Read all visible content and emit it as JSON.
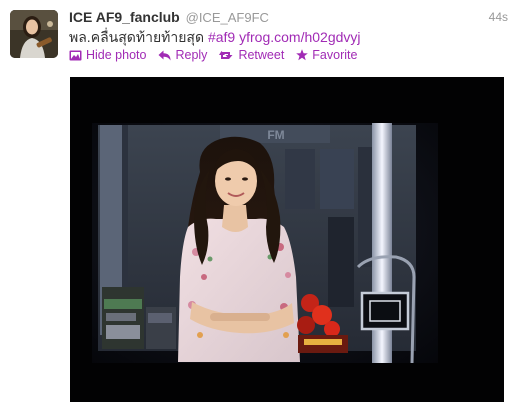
{
  "tweet": {
    "display_name": "ICE AF9_fanclub",
    "screen_name": "@ICE_AF9FC",
    "timestamp": "44s",
    "text_plain": "พล.คลื่นสุดท้ายท้ายสุด",
    "hashtag": "#af9",
    "link": "yfrog.com/h02gdvyj",
    "link_color": "#a12bb5",
    "actions": {
      "hide_photo": "Hide photo",
      "reply": "Reply",
      "retweet": "Retweet",
      "favorite": "Favorite"
    },
    "photo": {
      "sign_text": "FM"
    }
  }
}
